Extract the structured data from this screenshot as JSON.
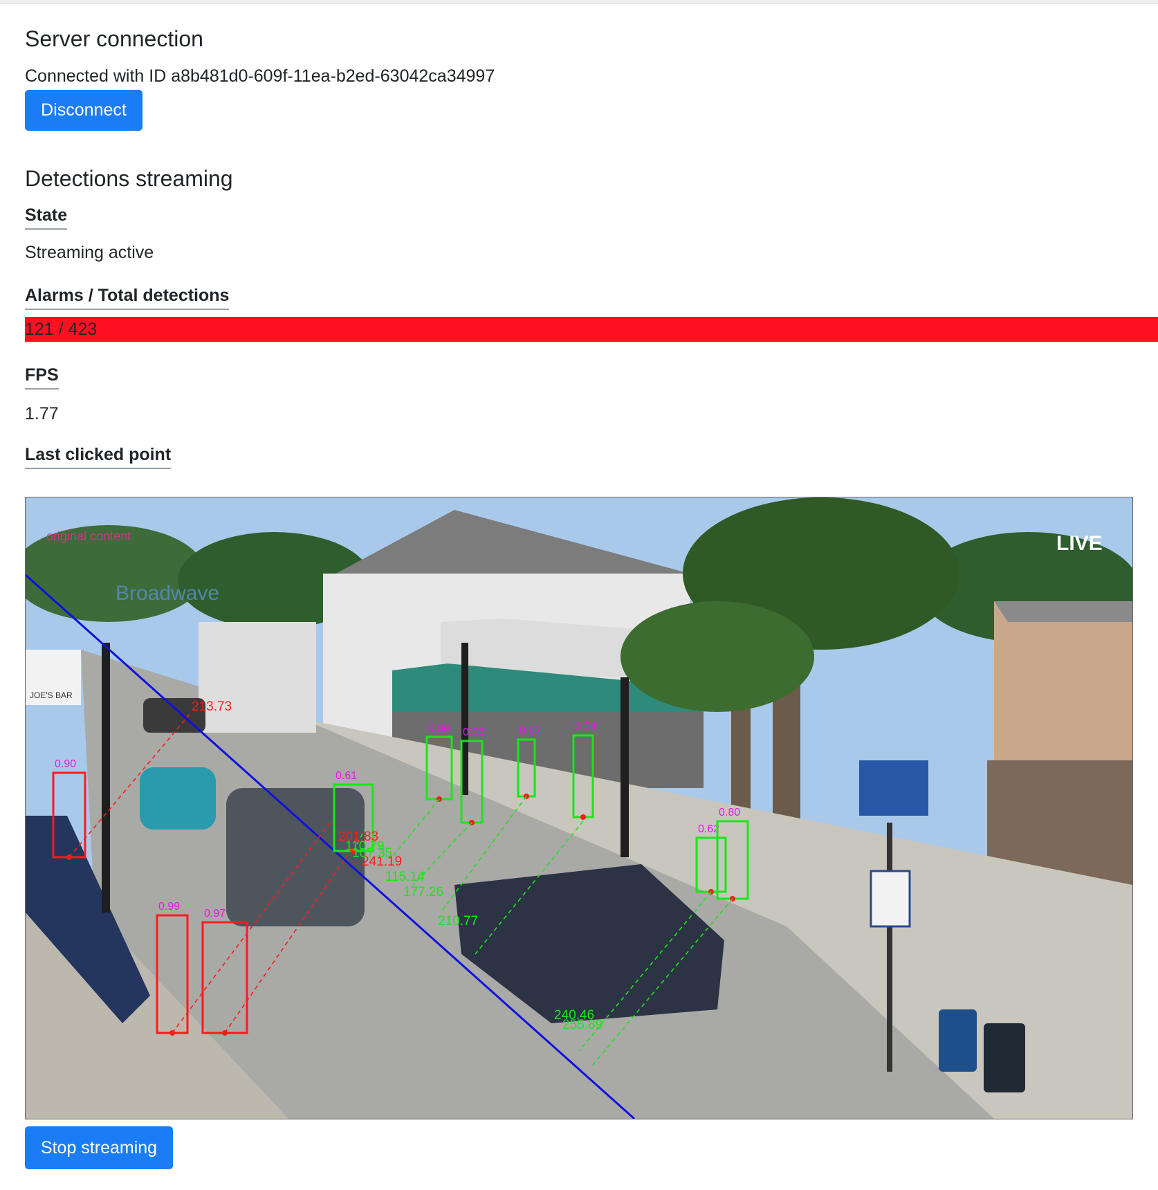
{
  "server": {
    "title": "Server connection",
    "status": "Connected with ID a8b481d0-609f-11ea-b2ed-63042ca34997",
    "disconnect_label": "Disconnect"
  },
  "streaming": {
    "title": "Detections streaming",
    "state_label": "State",
    "state_value": "Streaming active",
    "alarms_label": "Alarms / Total detections",
    "alarms_value": "121 / 423",
    "alarm_bar_color": "#ff1020",
    "fps_label": "FPS",
    "fps_value": "1.77",
    "last_point_label": "Last clicked point",
    "stop_label": "Stop streaming"
  },
  "video": {
    "overlay_live": "LIVE",
    "watermark_top": "original content",
    "watermark_brand": "Broadwave",
    "sign_text": "JOE'S BAR",
    "colors": {
      "alarm": "#ff1a1a",
      "ok": "#19e619",
      "score": "#e619e6",
      "line": "#1010e0"
    },
    "detections": [
      {
        "score": "0.90",
        "alarm": true
      },
      {
        "score": "0.99",
        "alarm": true
      },
      {
        "score": "0.97",
        "alarm": true
      },
      {
        "score": "0.61",
        "alarm": false
      },
      {
        "score": "0.98",
        "alarm": false
      },
      {
        "score": "0.58",
        "alarm": false
      },
      {
        "score": "0.62",
        "alarm": false
      },
      {
        "score": "0.54",
        "alarm": false
      },
      {
        "score": "0.62",
        "alarm": false
      },
      {
        "score": "0.80",
        "alarm": false
      }
    ],
    "distances": [
      {
        "text": "213.73",
        "alarm": true
      },
      {
        "text": "201.83",
        "alarm": true
      },
      {
        "text": "241.19",
        "alarm": true
      },
      {
        "text": "110.79",
        "alarm": false
      },
      {
        "text": "107.35",
        "alarm": false
      },
      {
        "text": "115.14",
        "alarm": false
      },
      {
        "text": "177.26",
        "alarm": false
      },
      {
        "text": "210.77",
        "alarm": false
      },
      {
        "text": "240.46",
        "alarm": false
      },
      {
        "text": "255.89",
        "alarm": false
      }
    ]
  }
}
